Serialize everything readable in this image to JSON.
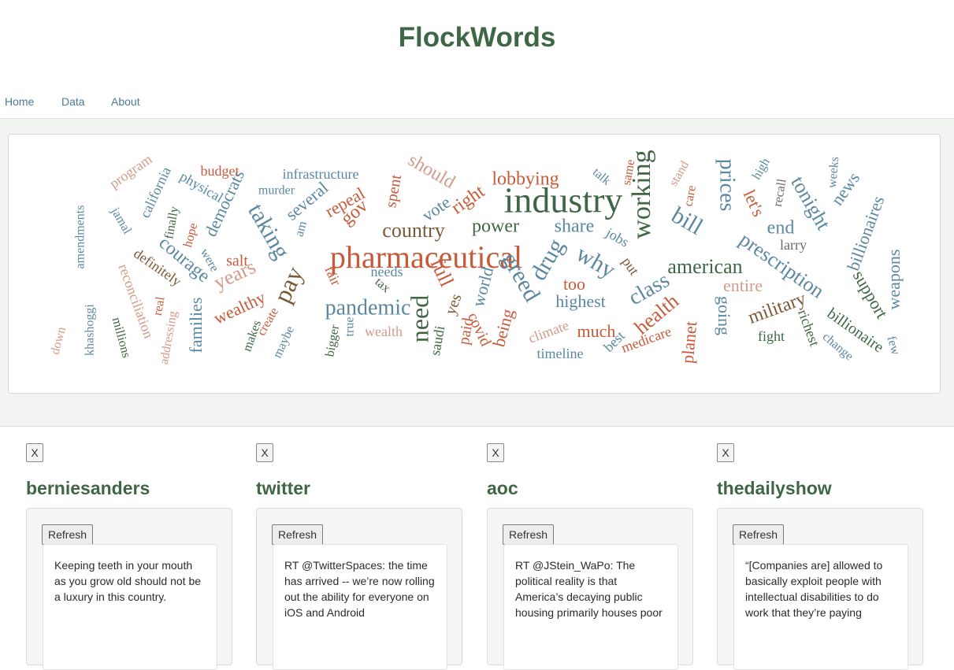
{
  "app": {
    "title": "FlockWords"
  },
  "nav": {
    "items": [
      "Home",
      "Data",
      "About"
    ]
  },
  "wordcloud": {
    "words": [
      {
        "text": "industry",
        "color": "#3f6645"
      },
      {
        "text": "pharmaceutical",
        "color": "#c85a3a"
      },
      {
        "text": "working",
        "color": "#3f6645"
      },
      {
        "text": "need",
        "color": "#3f6645"
      },
      {
        "text": "greed",
        "color": "#5b88a0"
      },
      {
        "text": "drug",
        "color": "#5b88a0"
      },
      {
        "text": "why",
        "color": "#5b88a0"
      },
      {
        "text": "pay",
        "color": "#7a5a36"
      },
      {
        "text": "taking",
        "color": "#5b88a0"
      },
      {
        "text": "bill",
        "color": "#5b88a0"
      },
      {
        "text": "prices",
        "color": "#5b88a0"
      },
      {
        "text": "prescription",
        "color": "#5b88a0"
      },
      {
        "text": "pandemic",
        "color": "#5b88a0"
      },
      {
        "text": "country",
        "color": "#7a5a36"
      },
      {
        "text": "american",
        "color": "#3f6645"
      },
      {
        "text": "class",
        "color": "#5b88a0"
      },
      {
        "text": "tonight",
        "color": "#5b88a0"
      },
      {
        "text": "full",
        "color": "#c85a3a"
      },
      {
        "text": "health",
        "color": "#c85a3a"
      },
      {
        "text": "gov",
        "color": "#c85a3a"
      },
      {
        "text": "years",
        "color": "#d49a8a"
      },
      {
        "text": "power",
        "color": "#3f6645"
      },
      {
        "text": "lobbying",
        "color": "#c85a3a"
      },
      {
        "text": "should",
        "color": "#d49a8a"
      },
      {
        "text": "right",
        "color": "#c85a3a"
      },
      {
        "text": "repeal",
        "color": "#c85a3a"
      },
      {
        "text": "several",
        "color": "#5b88a0"
      },
      {
        "text": "vote",
        "color": "#5b88a0"
      },
      {
        "text": "spent",
        "color": "#c85a3a"
      },
      {
        "text": "let's",
        "color": "#c85a3a"
      },
      {
        "text": "end",
        "color": "#5b88a0"
      },
      {
        "text": "news",
        "color": "#5b88a0"
      },
      {
        "text": "billionaires",
        "color": "#5b88a0"
      },
      {
        "text": "support",
        "color": "#3f6645"
      },
      {
        "text": "weapons",
        "color": "#5b88a0"
      },
      {
        "text": "billionaire",
        "color": "#3f6645"
      },
      {
        "text": "military",
        "color": "#7a5a36"
      },
      {
        "text": "going",
        "color": "#5b88a0"
      },
      {
        "text": "planet",
        "color": "#c85a3a"
      },
      {
        "text": "highest",
        "color": "#5b88a0"
      },
      {
        "text": "share",
        "color": "#5b88a0"
      },
      {
        "text": "too",
        "color": "#c85a3a"
      },
      {
        "text": "much",
        "color": "#c85a3a"
      },
      {
        "text": "entire",
        "color": "#d49a8a"
      },
      {
        "text": "wealthy",
        "color": "#c85a3a"
      },
      {
        "text": "salt",
        "color": "#c85a3a"
      },
      {
        "text": "courage",
        "color": "#5b88a0"
      },
      {
        "text": "democrats",
        "color": "#5b88a0"
      },
      {
        "text": "families",
        "color": "#5b88a0"
      },
      {
        "text": "world",
        "color": "#5b88a0"
      },
      {
        "text": "being",
        "color": "#c85a3a"
      },
      {
        "text": "covid",
        "color": "#c85a3a"
      },
      {
        "text": "paid",
        "color": "#c85a3a"
      },
      {
        "text": "yes",
        "color": "#7a5a36"
      },
      {
        "text": "saudi",
        "color": "#3f6645"
      },
      {
        "text": "wealth",
        "color": "#d49a8a"
      },
      {
        "text": "climate",
        "color": "#d49a8a"
      },
      {
        "text": "medicare",
        "color": "#c85a3a"
      },
      {
        "text": "timeline",
        "color": "#5b88a0"
      },
      {
        "text": "best",
        "color": "#5b88a0"
      },
      {
        "text": "put",
        "color": "#7a5a36"
      },
      {
        "text": "jobs",
        "color": "#5b88a0"
      },
      {
        "text": "larry",
        "color": "#6a6a6a"
      },
      {
        "text": "recall",
        "color": "#6a6a6a"
      },
      {
        "text": "high",
        "color": "#5b88a0"
      },
      {
        "text": "weeks",
        "color": "#5b88a0"
      },
      {
        "text": "care",
        "color": "#c85a3a"
      },
      {
        "text": "stand",
        "color": "#d49a8a"
      },
      {
        "text": "same",
        "color": "#c85a3a"
      },
      {
        "text": "talk",
        "color": "#5b88a0"
      },
      {
        "text": "fight",
        "color": "#3f6645"
      },
      {
        "text": "richest",
        "color": "#3f6645"
      },
      {
        "text": "change",
        "color": "#5b88a0"
      },
      {
        "text": "few",
        "color": "#5b88a0"
      },
      {
        "text": "infrastructure",
        "color": "#5b88a0"
      },
      {
        "text": "murder",
        "color": "#5b88a0"
      },
      {
        "text": "budget",
        "color": "#c85a3a"
      },
      {
        "text": "physical",
        "color": "#5b88a0"
      },
      {
        "text": "california",
        "color": "#5b88a0"
      },
      {
        "text": "program",
        "color": "#d49a8a"
      },
      {
        "text": "jamal",
        "color": "#5b88a0"
      },
      {
        "text": "finally",
        "color": "#3f6645"
      },
      {
        "text": "hope",
        "color": "#c85a3a"
      },
      {
        "text": "were",
        "color": "#5b88a0"
      },
      {
        "text": "am",
        "color": "#5b88a0"
      },
      {
        "text": "definitely",
        "color": "#7a5a36"
      },
      {
        "text": "real",
        "color": "#c85a3a"
      },
      {
        "text": "reconciliation",
        "color": "#d49a8a"
      },
      {
        "text": "addressing",
        "color": "#d49a8a"
      },
      {
        "text": "amendments",
        "color": "#5b88a0"
      },
      {
        "text": "khashoggi",
        "color": "#5b88a0"
      },
      {
        "text": "millions",
        "color": "#3f6645"
      },
      {
        "text": "down",
        "color": "#d49a8a"
      },
      {
        "text": "makes",
        "color": "#3f6645"
      },
      {
        "text": "create",
        "color": "#c85a3a"
      },
      {
        "text": "maybe",
        "color": "#5b88a0"
      },
      {
        "text": "bigger",
        "color": "#3f6645"
      },
      {
        "text": "true",
        "color": "#5b88a0"
      },
      {
        "text": "needs",
        "color": "#5b88a0"
      },
      {
        "text": "tax",
        "color": "#3f6645"
      },
      {
        "text": "fair",
        "color": "#c85a3a"
      }
    ]
  },
  "feeds": [
    {
      "close_label": "X",
      "name": "berniesanders",
      "refresh_label": "Refresh",
      "tweet": "Keeping teeth in your mouth as you grow old should not be a luxury in this country."
    },
    {
      "close_label": "X",
      "name": "twitter",
      "refresh_label": "Refresh",
      "tweet": "RT @TwitterSpaces: the time has arrived -- we’re now rolling out the ability for everyone on iOS and Android"
    },
    {
      "close_label": "X",
      "name": "aoc",
      "refresh_label": "Refresh",
      "tweet": "RT @JStein_WaPo: The political reality is that America’s decaying public housing primarily houses poor"
    },
    {
      "close_label": "X",
      "name": "thedailyshow",
      "refresh_label": "Refresh",
      "tweet": "“[Companies are] allowed to basically exploit people with intellectual disabilities to do work that they’re paying"
    }
  ]
}
